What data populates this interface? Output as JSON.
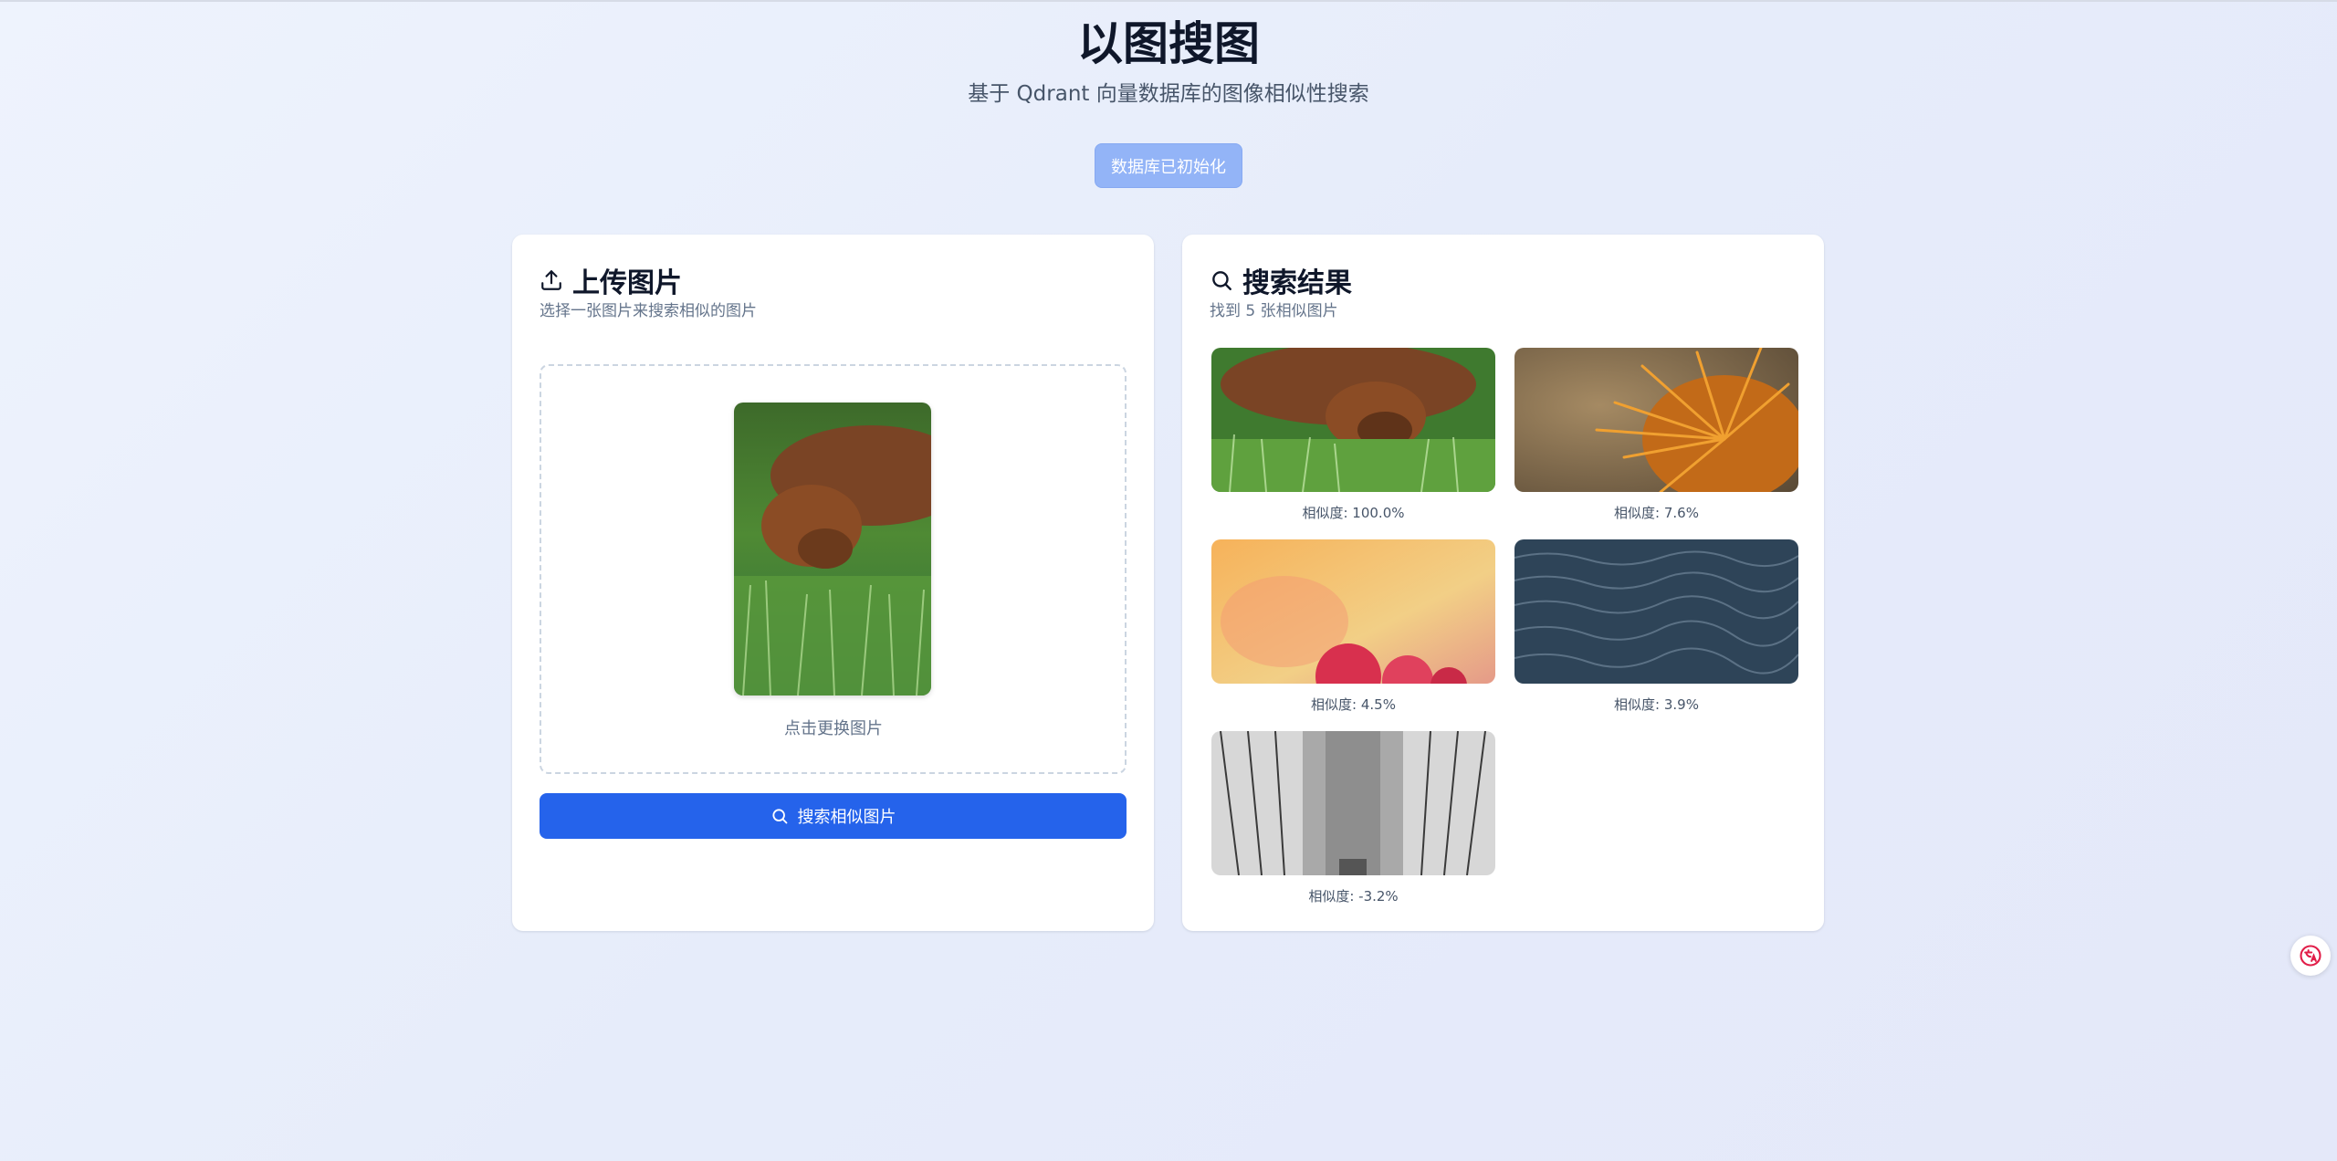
{
  "header": {
    "title": "以图搜图",
    "subtitle": "基于 Qdrant 向量数据库的图像相似性搜索"
  },
  "status_button": {
    "label": "数据库已初始化"
  },
  "upload_card": {
    "title": "上传图片",
    "description": "选择一张图片来搜索相似的图片",
    "change_hint": "点击更换图片",
    "search_button": "搜索相似图片",
    "icon": "upload-icon"
  },
  "results_card": {
    "title": "搜索结果",
    "description": "找到 5 张相似图片",
    "icon": "search-icon",
    "results": [
      {
        "score": "相似度: 100.0%",
        "image": "dog-in-grass"
      },
      {
        "score": "相似度: 7.6%",
        "image": "spiky-chestnut"
      },
      {
        "score": "相似度: 4.5%",
        "image": "raspberries"
      },
      {
        "score": "相似度: 3.9%",
        "image": "ocean-waves"
      },
      {
        "score": "相似度: -3.2%",
        "image": "bridge-cables"
      }
    ]
  },
  "colors": {
    "accent": "#2563eb",
    "status_button": "#93b4f7",
    "translate_icon": "#e11d48"
  },
  "translate_widget": {
    "icon": "translate-icon"
  }
}
